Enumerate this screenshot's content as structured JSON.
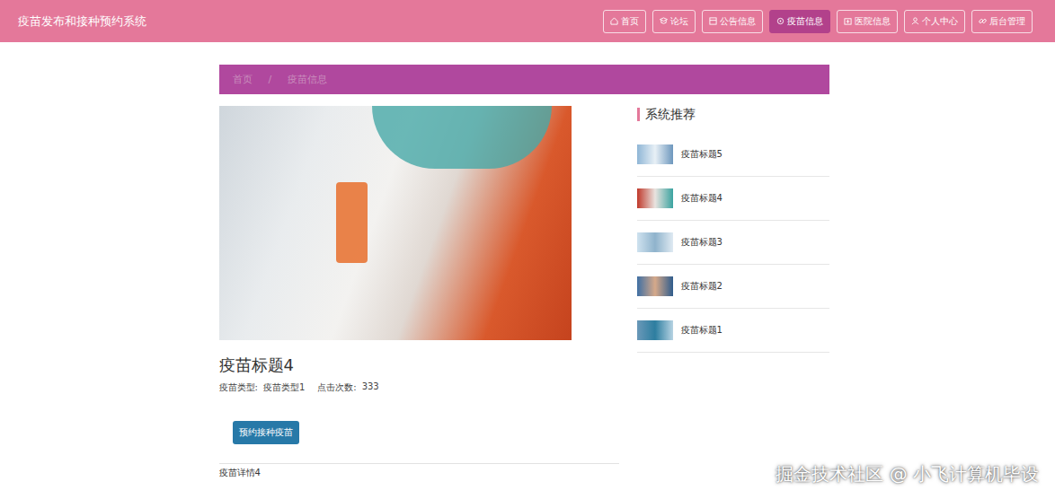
{
  "app": {
    "title": "疫苗发布和接种预约系统"
  },
  "nav": [
    {
      "label": "首页",
      "selected": false
    },
    {
      "label": "论坛",
      "selected": false
    },
    {
      "label": "公告信息",
      "selected": false
    },
    {
      "label": "疫苗信息",
      "selected": true
    },
    {
      "label": "医院信息",
      "selected": false
    },
    {
      "label": "个人中心",
      "selected": false
    },
    {
      "label": "后台管理",
      "selected": false
    }
  ],
  "breadcrumb": [
    "首页",
    "/",
    "疫苗信息"
  ],
  "vaccine": {
    "title": "疫苗标题4",
    "type_label": "疫苗类型:",
    "type": "疫苗类型1",
    "clicks_label": "点击次数:",
    "clicks": "333",
    "book_button": "预约接种疫苗",
    "detail": "疫苗详情4"
  },
  "recommend": {
    "title": "系统推荐",
    "items": [
      "疫苗标题5",
      "疫苗标题4",
      "疫苗标题3",
      "疫苗标题2",
      "疫苗标题1"
    ]
  },
  "watermark": "掘金技术社区 @ 小飞计算机毕设"
}
